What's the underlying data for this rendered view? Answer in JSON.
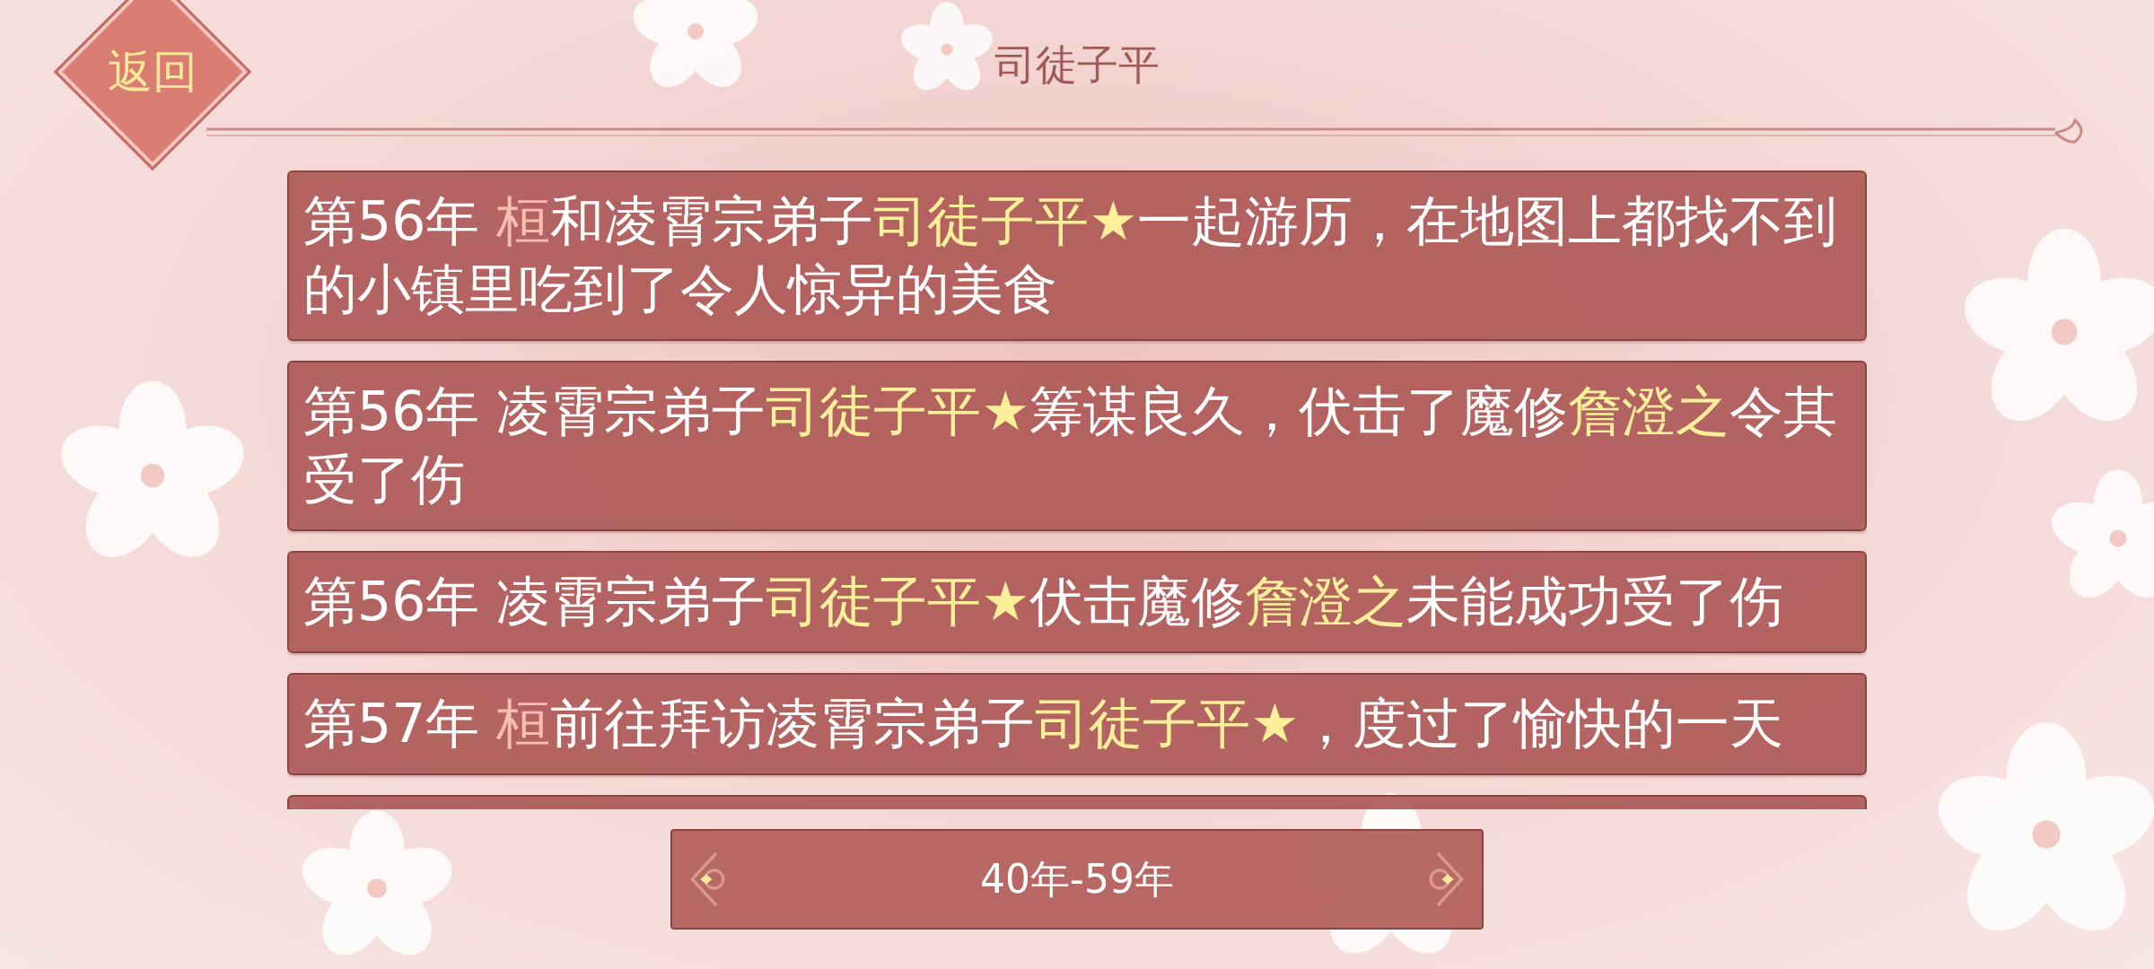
{
  "header": {
    "back_button": "返回",
    "title": "司徒子平"
  },
  "events": [
    {
      "segments": [
        {
          "kind": "plain",
          "text": "第56年 "
        },
        {
          "kind": "self",
          "text": "桓"
        },
        {
          "kind": "plain",
          "text": "和凌霄宗弟子"
        },
        {
          "kind": "name",
          "text": "司徒子平★"
        },
        {
          "kind": "plain",
          "text": "一起游历，在地图上都找不到的小镇里吃到了令人惊异的美食"
        }
      ]
    },
    {
      "segments": [
        {
          "kind": "plain",
          "text": "第56年 凌霄宗弟子"
        },
        {
          "kind": "name",
          "text": "司徒子平★"
        },
        {
          "kind": "plain",
          "text": "筹谋良久，伏击了魔修"
        },
        {
          "kind": "name",
          "text": "詹澄之"
        },
        {
          "kind": "plain",
          "text": "令其受了伤"
        }
      ]
    },
    {
      "segments": [
        {
          "kind": "plain",
          "text": "第56年 凌霄宗弟子"
        },
        {
          "kind": "name",
          "text": "司徒子平★"
        },
        {
          "kind": "plain",
          "text": "伏击魔修"
        },
        {
          "kind": "name",
          "text": "詹澄之"
        },
        {
          "kind": "plain",
          "text": "未能成功受了伤"
        }
      ]
    },
    {
      "segments": [
        {
          "kind": "plain",
          "text": "第57年 "
        },
        {
          "kind": "self",
          "text": "桓"
        },
        {
          "kind": "plain",
          "text": "前往拜访凌霄宗弟子"
        },
        {
          "kind": "name",
          "text": "司徒子平★"
        },
        {
          "kind": "plain",
          "text": "，度过了愉快的一天"
        }
      ]
    }
  ],
  "period_selector": {
    "label": "40年-59年"
  }
}
